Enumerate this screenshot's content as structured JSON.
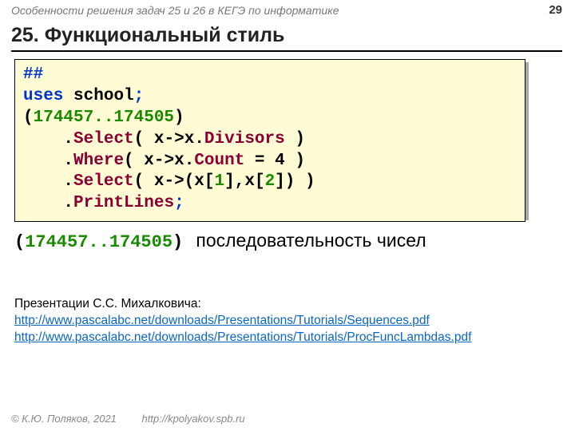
{
  "header": {
    "subtitle": "Особенности решения задач 25 и 26 в КЕГЭ по информатике",
    "page": "29"
  },
  "title": "25. Функциональный стиль",
  "code": {
    "l1": "##",
    "l2_uses": "uses",
    "l2_school": "school",
    "range": "174457..174505",
    "select": "Select",
    "where": "Where",
    "printlines": "PrintLines",
    "divisors": "Divisors",
    "count": "Count",
    "x": "x",
    "eq4": " = 4"
  },
  "sequence": {
    "range": "(174457..174505)",
    "text": "последовательность чисел"
  },
  "refs": {
    "intro": "Презентации С.С. Михалковича:",
    "link1": "http://www.pascalabc.net/downloads/Presentations/Tutorials/Sequences.pdf",
    "link2": "http://www.pascalabc.net/downloads/Presentations/Tutorials/ProcFuncLambdas.pdf"
  },
  "footer": {
    "copy": "© К.Ю. Поляков, 2021",
    "url": "http://kpolyakov.spb.ru"
  }
}
